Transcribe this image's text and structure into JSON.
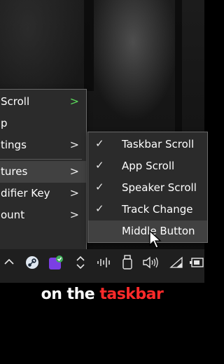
{
  "main_menu": {
    "items": [
      {
        "label": "Scroll",
        "chevron": ">",
        "chevron_color": "#5ad85a"
      },
      {
        "label": "p",
        "chevron": ""
      },
      {
        "label": "tings",
        "chevron": ">"
      },
      {
        "label": "tures",
        "chevron": ">"
      },
      {
        "label": "difier Key",
        "chevron": ">"
      },
      {
        "label": "ount",
        "chevron": ">"
      }
    ]
  },
  "sub_menu": {
    "items": [
      {
        "label": "Taskbar Scroll",
        "checked": true
      },
      {
        "label": "App Scroll",
        "checked": true
      },
      {
        "label": "Speaker Scroll",
        "checked": true
      },
      {
        "label": "Track Change",
        "checked": true
      },
      {
        "label": "Middle Button",
        "checked": false
      }
    ],
    "check_glyph": "✓"
  },
  "taskbar": {
    "icons": [
      "chevron-up-icon",
      "steam-icon",
      "app-icon",
      "up-down-arrows-icon",
      "audio-wave-icon",
      "usb-drive-icon",
      "speaker-icon",
      "wifi-icon",
      "battery-icon"
    ]
  },
  "caption": {
    "part1": "on the",
    "part2": "taskbar",
    "accent_color": "#ff2a2a"
  }
}
